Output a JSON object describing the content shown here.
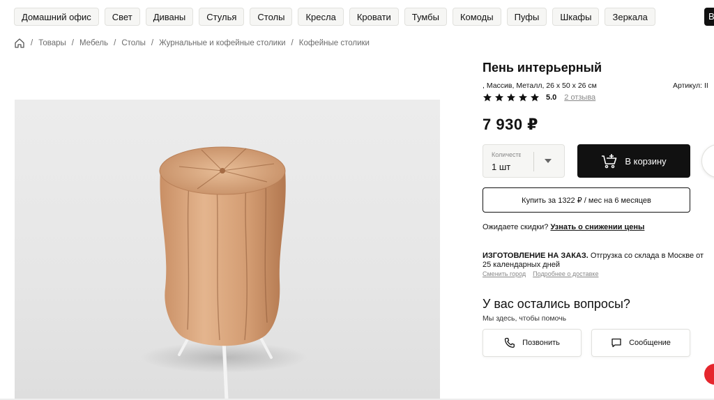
{
  "categories": [
    "Домашний офис",
    "Свет",
    "Диваны",
    "Стулья",
    "Столы",
    "Кресла",
    "Кровати",
    "Тумбы",
    "Комоды",
    "Пуфы",
    "Шкафы",
    "Зеркала"
  ],
  "categories_more": "В",
  "breadcrumb": [
    "Товары",
    "Мебель",
    "Столы",
    "Журнальные и кофейные столики",
    "Кофейные столики"
  ],
  "product": {
    "title": "Пень интерьерный",
    "specs": ", Массив, Металл, 26 x 50 x 26 см",
    "sku": "Артикул: II",
    "rating_value": "5.0",
    "rating_stars": 5,
    "reviews": "2 отзыва",
    "price": "7 930 ₽"
  },
  "quantity": {
    "label": "Количество",
    "value": "1 шт"
  },
  "cart_button": "В корзину",
  "credit_button": "Купить за 1322 ₽ / мес на 6 месяцев",
  "discount": {
    "text": "Ожидаете скидки?",
    "link": "Узнать о снижении цены"
  },
  "made_to_order": {
    "title": "ИЗГОТОВЛЕНИЕ НА ЗАКАЗ.",
    "text": "Отгрузка со склада в Москве от",
    "text2": "25 календарных дней",
    "link_city": "Сменить город",
    "link_delivery": "Подробнее о доставке"
  },
  "questions": {
    "title": "У вас остались вопросы?",
    "subtitle": "Мы здесь, чтобы помочь",
    "call": "Позвонить",
    "message": "Сообщение"
  },
  "colors": {
    "accent": "#111111",
    "chat": "#e5262d",
    "chip_bg": "#f6f6f4"
  }
}
